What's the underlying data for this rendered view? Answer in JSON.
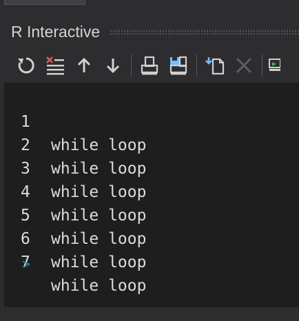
{
  "window": {
    "top_tab_label": "",
    "title": "R Interactive"
  },
  "toolbar": {
    "buttons": [
      {
        "name": "reset",
        "icon": "reset-icon"
      },
      {
        "name": "clear",
        "icon": "clear-icon"
      },
      {
        "name": "history-up",
        "icon": "arrow-up-icon"
      },
      {
        "name": "history-down",
        "icon": "arrow-down-icon"
      },
      {
        "name": "load-workspace",
        "icon": "load-workspace-icon"
      },
      {
        "name": "save-workspace",
        "icon": "save-workspace-icon"
      },
      {
        "name": "load-history",
        "icon": "load-history-icon"
      },
      {
        "name": "delete",
        "icon": "delete-icon",
        "disabled": true
      },
      {
        "name": "more",
        "icon": "more-icon"
      }
    ]
  },
  "console": {
    "lines": [
      {
        "num": "1",
        "text": "while loop"
      },
      {
        "num": "2",
        "text": "while loop"
      },
      {
        "num": "3",
        "text": "while loop"
      },
      {
        "num": "4",
        "text": "while loop"
      },
      {
        "num": "5",
        "text": "while loop"
      },
      {
        "num": "6",
        "text": "while loop"
      },
      {
        "num": "7",
        "text": "while loop"
      }
    ],
    "prompt": ">"
  },
  "colors": {
    "chrome": "#2d2d30",
    "console_bg": "#1e1e1e",
    "text": "#dcdcdc",
    "prompt": "#1f8ca0",
    "save_accent": "#75beff"
  }
}
